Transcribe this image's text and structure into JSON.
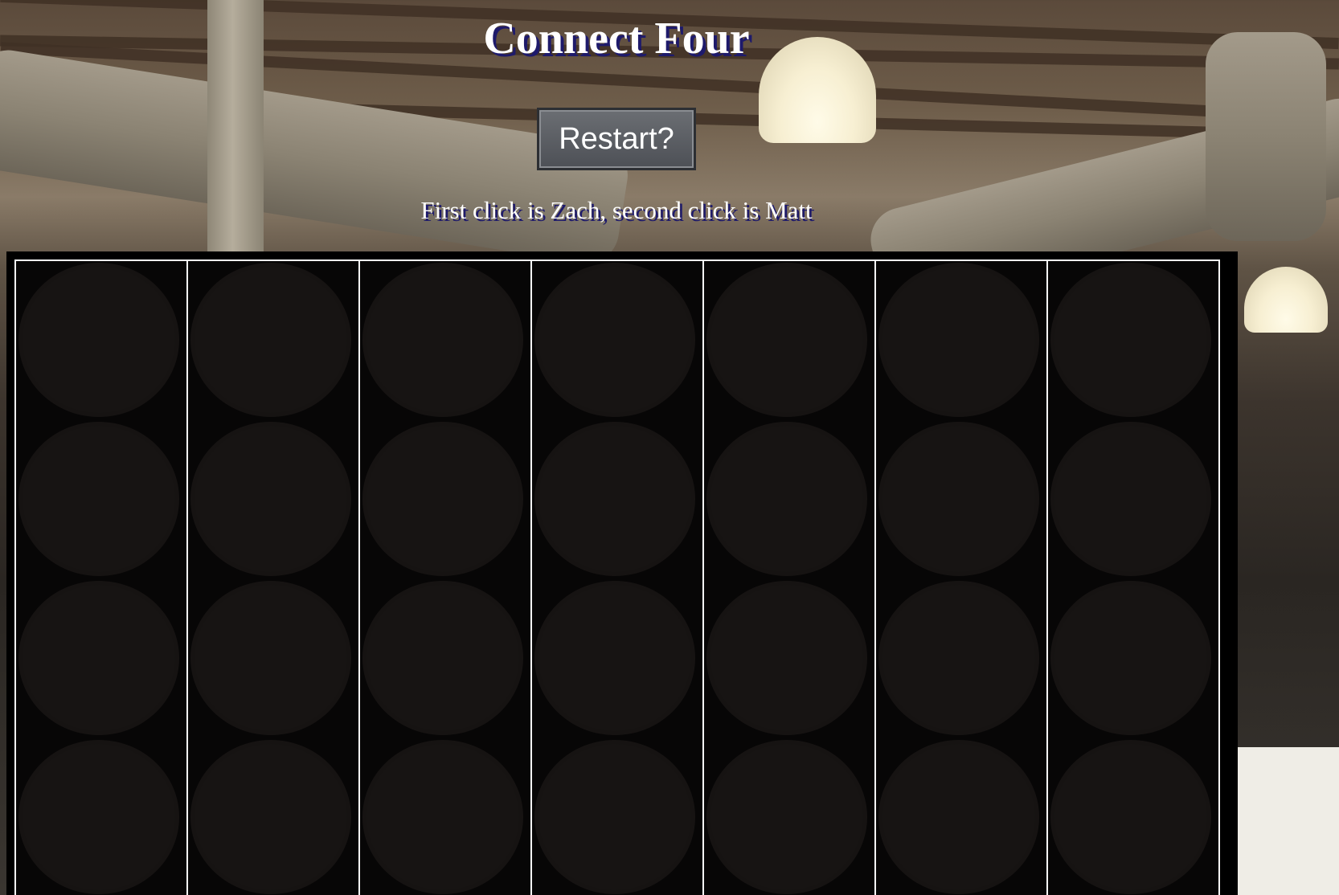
{
  "header": {
    "title": "Connect Four",
    "restart_label": "Restart?",
    "instructions": "First click is Zach, second click is Matt"
  },
  "board": {
    "columns": 7,
    "visible_rows": 4,
    "cells": [
      [
        "empty",
        "empty",
        "empty",
        "empty",
        "empty",
        "empty",
        "empty"
      ],
      [
        "empty",
        "empty",
        "empty",
        "empty",
        "empty",
        "empty",
        "empty"
      ],
      [
        "empty",
        "empty",
        "empty",
        "empty",
        "empty",
        "empty",
        "empty"
      ],
      [
        "empty",
        "empty",
        "empty",
        "empty",
        "empty",
        "empty",
        "empty"
      ]
    ]
  },
  "players": [
    "Zach",
    "Matt"
  ],
  "colors": {
    "title_shadow": "#1e1a6b",
    "button_bg": "#5a5d62",
    "column_divider": "#ffffff",
    "board_border": "#000000"
  }
}
